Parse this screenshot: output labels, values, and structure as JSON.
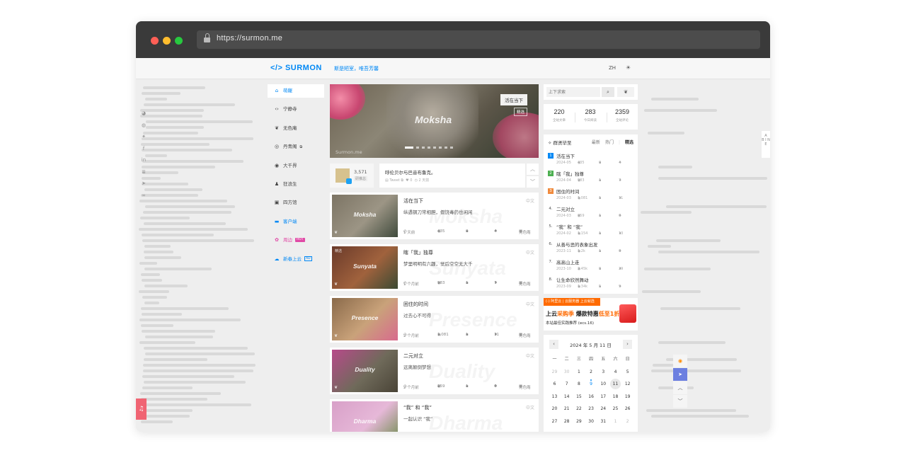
{
  "browser": {
    "url": "https://surmon.me"
  },
  "header": {
    "logo": "</> SURMON",
    "slogan": "斯是陋室，唯吾芳馨",
    "lang": "ZH",
    "theme_icon": "sun-icon"
  },
  "nav": [
    {
      "label": "萌寵",
      "icon": "home-icon",
      "active": true
    },
    {
      "label": "宁静寺",
      "icon": "code-icon"
    },
    {
      "label": "无色庵",
      "icon": "lotus-icon"
    },
    {
      "label": "丹青阁",
      "icon": "github-icon",
      "badge": "⧉"
    },
    {
      "label": "大千界",
      "icon": "globe-icon"
    },
    {
      "label": "狂浪生",
      "icon": "person-icon"
    },
    {
      "label": "四方馆",
      "icon": "chat-icon"
    },
    {
      "label": "客户端",
      "icon": "app-icon",
      "color": "blue"
    },
    {
      "label": "周边",
      "icon": "shop-icon",
      "color": "pink",
      "tag": "HOT"
    },
    {
      "label": "新春上云",
      "icon": "cloud-icon",
      "color": "blue",
      "tag": "AD"
    }
  ],
  "side_icons": [
    "wechat-icon",
    "weibo-icon",
    "twitter-icon",
    "facebook-icon",
    "linkedin-icon",
    "menu-icon",
    "telegram-icon",
    "link-icon"
  ],
  "carousel": {
    "title": "Moksha",
    "badge": "活在当下",
    "pick": "精选",
    "site": "Surmon.me",
    "slides": 8
  },
  "tweet": {
    "count": "3,571",
    "count_label": "研推总",
    "text": "呼伦贝尔与巴音布鲁克。",
    "meta_source": "Tweet ⧉",
    "meta_likes": "0",
    "meta_time": "2 天前"
  },
  "articles": [
    {
      "thumb_title": "Moksha",
      "title": "活在当下",
      "desc": "纵遇钢刀常相胆，假饶毒药也闲闲",
      "lang": "中文",
      "time": "1 天前",
      "views": "435",
      "comments": "0",
      "likes": "4",
      "category": "无色庵",
      "colors": [
        "#7c7464",
        "#9c9585",
        "#3f4a3c"
      ]
    },
    {
      "thumb_title": "Sunyata",
      "title": "瞎「我」独尊",
      "desc": "梦里明明有六趣，觉后空空无大千",
      "lang": "中文",
      "time": "1 个月前",
      "views": "983",
      "comments": "1",
      "likes": "7",
      "category": "无色庵",
      "pick": "精选",
      "colors": [
        "#6a3a2a",
        "#a0623d",
        "#3b4a33"
      ]
    },
    {
      "thumb_title": "Presence",
      "title": "困住的时间",
      "desc": "过去心不可得",
      "lang": "中文",
      "time": "2 个月前",
      "views": "1,081",
      "comments": "1",
      "likes": "11",
      "category": "无色庵",
      "colors": [
        "#8a6a4a",
        "#c9a27a",
        "#d86a8e"
      ]
    },
    {
      "thumb_title": "Duality",
      "title": "二元对立",
      "desc": "远离颠倒梦想",
      "lang": "中文",
      "time": "2 个月前",
      "views": "859",
      "comments": "1",
      "likes": "6",
      "category": "无色庵",
      "colors": [
        "#b74a8a",
        "#6f6a5a",
        "#4a4437"
      ]
    },
    {
      "thumb_title": "Dharma",
      "title": "“我” 和 “我”",
      "desc": "一起认识 “我”",
      "lang": "中文",
      "colors": [
        "#d8a0c8",
        "#e6b8d8",
        "#6a8a4a"
      ]
    }
  ],
  "search": {
    "placeholder": "上下求索",
    "search_icon": "search-icon",
    "lang_icon": "lotus-icon"
  },
  "stats": [
    {
      "value": "220",
      "label": "全站文章"
    },
    {
      "value": "283",
      "label": "今日阅读"
    },
    {
      "value": "2359",
      "label": "全站评论"
    }
  ],
  "hot": {
    "title": "群贤毕至",
    "tabs": [
      "最新",
      "热门",
      "精选"
    ],
    "active_tab": "精选",
    "items": [
      {
        "rank": "1",
        "title": "活在当下",
        "date": "2024-05",
        "views": "435",
        "comments": "0",
        "likes": "4"
      },
      {
        "rank": "2",
        "title": "瞎「我」独尊",
        "date": "2024-04",
        "views": "983",
        "comments": "1",
        "likes": "7"
      },
      {
        "rank": "3",
        "title": "困住的时间",
        "date": "2024-03",
        "views": "1,081",
        "comments": "1",
        "likes": "11"
      },
      {
        "rank": "4.",
        "title": "二元对立",
        "date": "2024-03",
        "views": "859",
        "comments": "1",
        "likes": "6"
      },
      {
        "rank": "5.",
        "title": "“我” 和 “我”",
        "date": "2024-02",
        "views": "1,154",
        "comments": "1",
        "likes": "13"
      },
      {
        "rank": "6.",
        "title": "从善与恶的表象出发",
        "date": "2023-11",
        "views": "1.2k",
        "comments": "1",
        "likes": "6"
      },
      {
        "rank": "7.",
        "title": "高高山上走",
        "date": "2023-10",
        "views": "2.45k",
        "comments": "9",
        "likes": "29"
      },
      {
        "rank": "8.",
        "title": "让生命欣然舞动",
        "date": "2023-09",
        "views": "1.34k",
        "comments": "5",
        "likes": "9"
      }
    ]
  },
  "ad": {
    "top": "(-) 阿里云 | 云服务器 上云就选",
    "line1_a": "上云",
    "line1_b": "采购季",
    "line1_c": " 爆款特惠",
    "line1_d": "低至1折",
    "line2": "本站最佳实践推荐 (ecs.16)"
  },
  "calendar": {
    "month": "2024 年 5 月 11 日",
    "weekdays": [
      "一",
      "二",
      "三",
      "四",
      "五",
      "六",
      "日"
    ],
    "today": "11",
    "marked": [
      "9"
    ],
    "days": [
      [
        "29",
        "30",
        "1",
        "2",
        "3",
        "4",
        "5"
      ],
      [
        "6",
        "7",
        "8",
        "9",
        "10",
        "11",
        "12"
      ],
      [
        "13",
        "14",
        "15",
        "16",
        "17",
        "18",
        "19"
      ],
      [
        "20",
        "21",
        "22",
        "23",
        "24",
        "25",
        "26"
      ],
      [
        "27",
        "28",
        "29",
        "30",
        "31",
        "1",
        "2"
      ]
    ],
    "dim_first_row": 2,
    "dim_last_row": 2
  },
  "sidetab": {
    "text": "B I N E"
  },
  "right_tools": [
    "rss-icon",
    "telegram-icon",
    "chevron-up-icon",
    "chevron-down-icon"
  ]
}
